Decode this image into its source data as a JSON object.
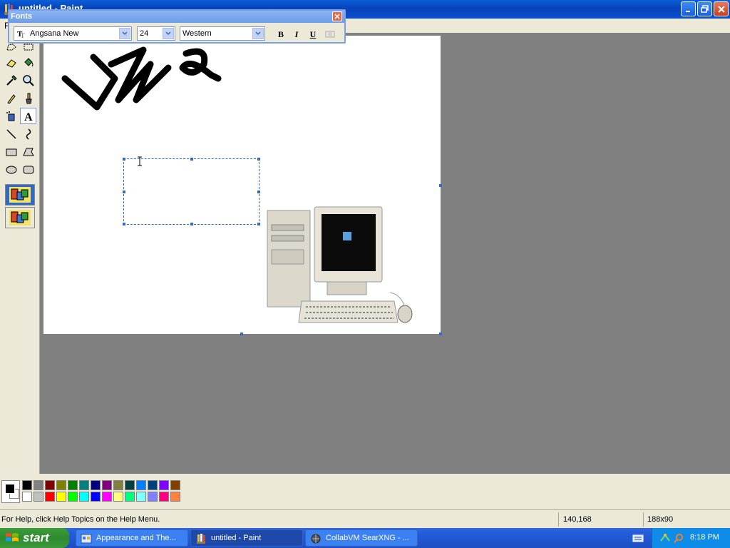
{
  "window": {
    "title": "untitled - Paint"
  },
  "menu": {
    "first_item": "F"
  },
  "fonts_toolbar": {
    "title": "Fonts",
    "font_name": "Angsana New",
    "font_size": "24",
    "script": "Western",
    "bold": "B",
    "italic": "I",
    "underline": "U"
  },
  "tools": [
    "free-form-select",
    "select",
    "eraser",
    "fill",
    "pick-color",
    "magnifier",
    "pencil",
    "brush",
    "airbrush",
    "text",
    "line",
    "curve",
    "rectangle",
    "polygon",
    "ellipse",
    "rounded-rectangle"
  ],
  "active_tool": "text",
  "palette": {
    "row1": [
      "#000000",
      "#808080",
      "#800000",
      "#808000",
      "#008000",
      "#008080",
      "#000080",
      "#800080",
      "#808040",
      "#004040",
      "#0080ff",
      "#004080",
      "#8000ff",
      "#804000"
    ],
    "row2": [
      "#ffffff",
      "#c0c0c0",
      "#ff0000",
      "#ffff00",
      "#00ff00",
      "#00ffff",
      "#0000ff",
      "#ff00ff",
      "#ffff80",
      "#00ff80",
      "#80ffff",
      "#8080ff",
      "#ff0080",
      "#ff8040"
    ],
    "foreground": "#000000",
    "background": "#ffffff"
  },
  "status": {
    "help": "For Help, click Help Topics on the Help Menu.",
    "coords": "140,168",
    "size": "188x90"
  },
  "taskbar": {
    "start": "start",
    "tasks": [
      "Appearance and The...",
      "untitled - Paint",
      "CollabVM SearXNG - ..."
    ],
    "clock": "8:18 PM"
  }
}
